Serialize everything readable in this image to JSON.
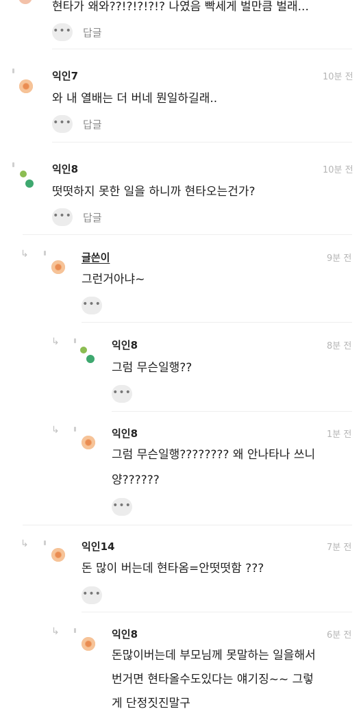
{
  "comments": [
    {
      "text": "현타가 왜와??!?!?!?!? 나였음 빡세게 벌만큼 벌래...",
      "reply_label": "답글"
    },
    {
      "name": "익인7",
      "time": "10분 전",
      "text": "와 내 열배는 더 버네 뭔일하길래..",
      "reply_label": "답글"
    },
    {
      "name": "익인8",
      "time": "10분 전",
      "text": "떳떳하지 못한 일을 하니까 현타오는건가?",
      "reply_label": "답글"
    }
  ],
  "replies": [
    {
      "name": "글쓴이",
      "time": "9분 전",
      "lines": [
        "그런거아냐~"
      ]
    },
    {
      "name": "익인8",
      "time": "8분 전",
      "lines": [
        "그럼 무슨일행??"
      ]
    },
    {
      "name": "익인8",
      "time": "1분 전",
      "lines": [
        "그럼 무슨일행???????? 왜 안나타나 쓰니",
        "양??????"
      ]
    },
    {
      "name": "익인14",
      "time": "7분 전",
      "lines": [
        "돈 많이 버는데 현타옴=안떳떳함 ???"
      ]
    },
    {
      "name": "익인8",
      "time": "6분 전",
      "lines": [
        "돈많이버는데 부모님께 못말하는 일을해서",
        "번거면 현타올수도있다는 얘기징~~ 그렇",
        "게 단정짓진말구"
      ]
    }
  ],
  "icons": {
    "more": "more-dots-icon",
    "reply_arrow": "reply-arrow-icon"
  },
  "colors": {
    "avatar_orange": "#f2a268",
    "avatar_green": "#3ea86f",
    "avatar_lightgreen": "#8cbd52"
  }
}
